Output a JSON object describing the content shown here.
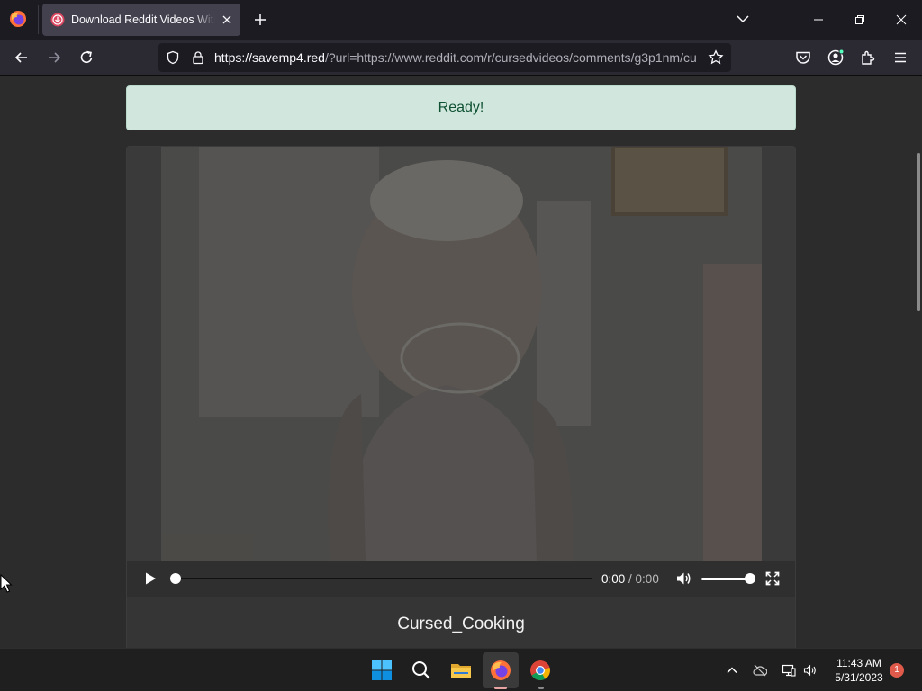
{
  "browser": {
    "tab": {
      "title": "Download Reddit Videos With S"
    },
    "url": {
      "domain": "https://savemp4.red",
      "rest": "/?url=https://www.reddit.com/r/cursedvideos/comments/g3p1nm/cu"
    }
  },
  "page": {
    "alert_text": "Ready!",
    "video": {
      "current_time": "0:00",
      "separator": " / ",
      "duration": "0:00",
      "progress": 0.0,
      "volume": 1.0,
      "title": "Cursed_Cooking"
    }
  },
  "taskbar": {
    "time": "11:43 AM",
    "date": "5/31/2023",
    "notification_count": "1"
  },
  "colors": {
    "alert_bg": "#d1e7dd",
    "alert_text": "#0f5132",
    "firefox_accent": "#ff7139",
    "notification": "#e05a4b"
  },
  "icons": [
    "firefox-icon",
    "download-favicon-icon",
    "close-icon",
    "plus-icon",
    "chevron-down-icon",
    "minimize-icon",
    "restore-icon",
    "back-icon",
    "forward-icon",
    "reload-icon",
    "shield-icon",
    "lock-icon",
    "star-icon",
    "pocket-icon",
    "account-icon",
    "extensions-icon",
    "menu-icon",
    "play-icon",
    "volume-icon",
    "fullscreen-icon",
    "windows-start-icon",
    "search-icon",
    "file-explorer-icon",
    "chrome-icon",
    "chevron-up-icon",
    "onedrive-icon",
    "network-icon",
    "speaker-icon"
  ]
}
